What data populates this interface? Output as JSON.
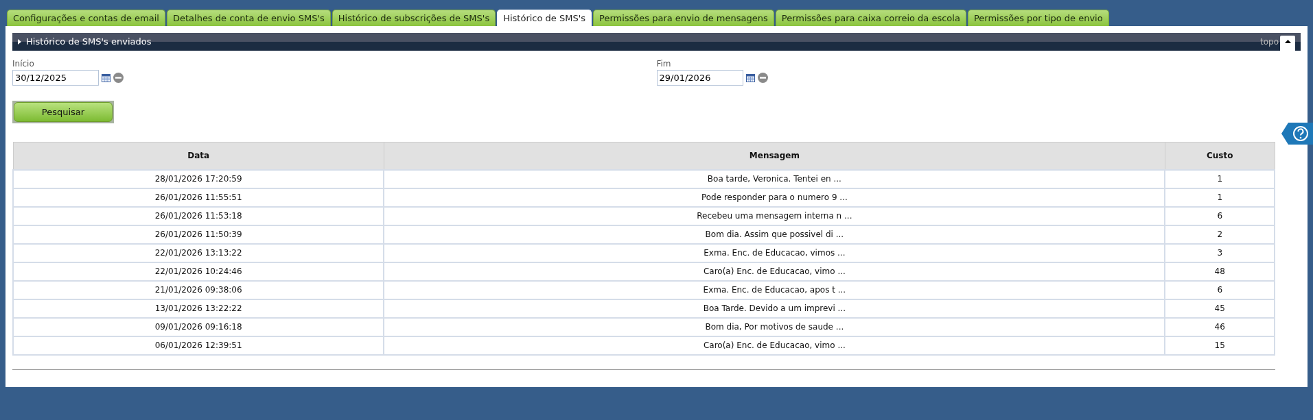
{
  "tabs": [
    {
      "label": "Configurações e contas de email",
      "selected": false
    },
    {
      "label": "Detalhes de conta de envio SMS's",
      "selected": false
    },
    {
      "label": "Histórico de subscrições de SMS's",
      "selected": false
    },
    {
      "label": "Histórico de SMS's",
      "selected": true
    },
    {
      "label": "Permissões para envio de mensagens",
      "selected": false
    },
    {
      "label": "Permissões para caixa correio da escola",
      "selected": false
    },
    {
      "label": "Permissões por tipo de envio",
      "selected": false
    }
  ],
  "section": {
    "title": "Histórico de SMS's enviados",
    "top_link": "topo"
  },
  "filters": [
    {
      "label": "Início",
      "value": "30/12/2025"
    },
    {
      "label": "Fim",
      "value": "29/01/2026"
    }
  ],
  "search_button": "Pesquisar",
  "table": {
    "columns": [
      "Data",
      "Mensagem",
      "Custo"
    ],
    "rows": [
      [
        "28/01/2026 17:20:59",
        "Boa tarde, Veronica. Tentei en ...",
        "1"
      ],
      [
        "26/01/2026 11:55:51",
        "Pode responder para o numero 9 ...",
        "1"
      ],
      [
        "26/01/2026 11:53:18",
        "Recebeu uma mensagem interna n ...",
        "6"
      ],
      [
        "26/01/2026 11:50:39",
        "Bom dia. Assim que possivel di ...",
        "2"
      ],
      [
        "22/01/2026 13:13:22",
        "Exma. Enc. de Educacao, vimos ...",
        "3"
      ],
      [
        "22/01/2026 10:24:46",
        "Caro(a) Enc. de Educacao, vimo ...",
        "48"
      ],
      [
        "21/01/2026 09:38:06",
        "Exma. Enc. de Educacao, apos t ...",
        "6"
      ],
      [
        "13/01/2026 13:22:22",
        "Boa Tarde. Devido a um imprevi ...",
        "45"
      ],
      [
        "09/01/2026 09:16:18",
        "Bom dia, Por motivos de saude ...",
        "46"
      ],
      [
        "06/01/2026 12:39:51",
        "Caro(a) Enc. de Educacao, vimo ...",
        "15"
      ]
    ]
  }
}
